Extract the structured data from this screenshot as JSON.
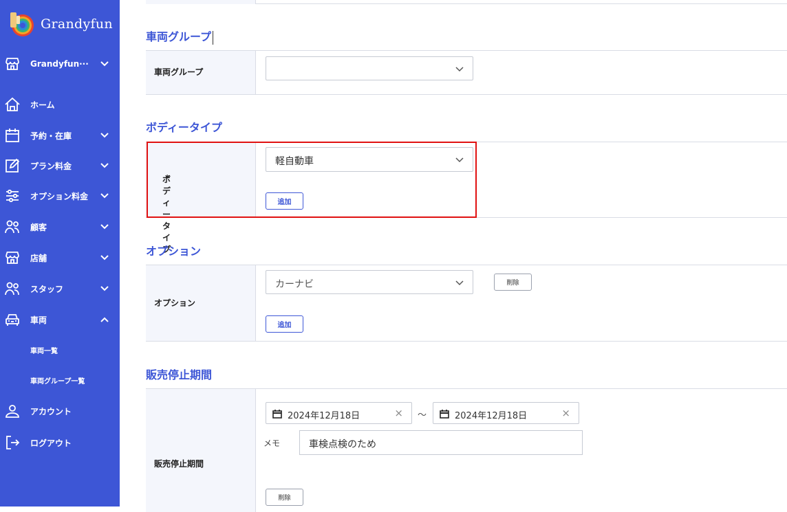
{
  "brand": {
    "name": "Grandyfun"
  },
  "sidebar": {
    "items": [
      {
        "label": "Grandyfun···",
        "icon": "store-icon"
      },
      {
        "label": "ホーム",
        "icon": "home-icon"
      },
      {
        "label": "予約・在庫",
        "icon": "calendar-icon"
      },
      {
        "label": "プラン料金",
        "icon": "edit-icon"
      },
      {
        "label": "オプション料金",
        "icon": "sliders-icon"
      },
      {
        "label": "顧客",
        "icon": "users-icon"
      },
      {
        "label": "店舗",
        "icon": "store-icon"
      },
      {
        "label": "スタッフ",
        "icon": "users-icon"
      },
      {
        "label": "車両",
        "icon": "car-icon"
      }
    ],
    "sub_items": [
      {
        "label": "車両一覧"
      },
      {
        "label": "車両グループ一覧"
      }
    ],
    "bottom": [
      {
        "label": "アカウント",
        "icon": "user-icon"
      },
      {
        "label": "ログアウト",
        "icon": "logout-icon"
      }
    ]
  },
  "sections": {
    "vehicle_group": {
      "title": "車両グループ",
      "field_label": "車両グループ",
      "value": ""
    },
    "body_type": {
      "title": "ボディータイプ",
      "field_label": "ボディータイプ",
      "required_mark": "*",
      "value": "軽自動車",
      "add_label": "追加"
    },
    "option": {
      "title": "オプション",
      "field_label": "オプション",
      "value": "カーナビ",
      "delete_label": "削除",
      "add_label": "追加"
    },
    "suspension": {
      "title": "販売停止期間",
      "field_label": "販売停止期間",
      "start_date": "2024年12月18日",
      "end_date": "2024年12月18日",
      "separator": "～",
      "memo_label": "メモ",
      "memo_value": "車検点検のため",
      "delete_label": "削除"
    }
  },
  "colors": {
    "sidebar": "#3d56d6",
    "accent": "#3d56d6",
    "highlight": "#e01010",
    "required": "#e0312b"
  }
}
